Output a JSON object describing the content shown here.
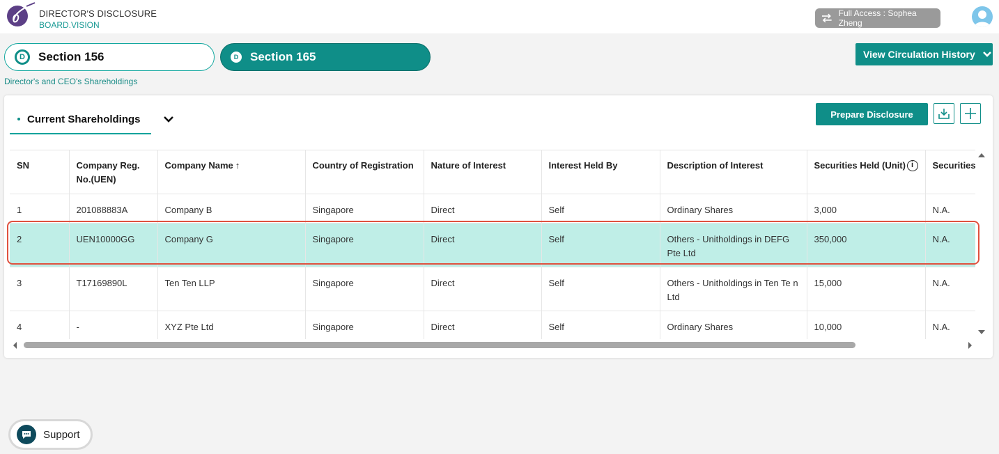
{
  "header": {
    "app_title": "DIRECTOR'S DISCLOSURE",
    "app_subtitle": "BOARD.VISION",
    "access_label": "Full Access : Sophea Zheng"
  },
  "sections": {
    "tab_156": "Section 156",
    "tab_165": "Section 165",
    "badge_letter": "D",
    "breadcrumb": "Director's and CEO's Shareholdings",
    "circulation_button": "View Circulation History"
  },
  "card": {
    "tab_label": "Current Shareholdings",
    "prepare_button": "Prepare Disclosure"
  },
  "table": {
    "columns": [
      "SN",
      "Company Reg. No.(UEN)",
      "Company Name",
      "Country of Registration",
      "Nature of Interest",
      "Interest Held By",
      "Description of Interest",
      "Securities Held (Unit)",
      "Securities"
    ],
    "sort_arrow": "↑",
    "info_glyph": "i",
    "rows": [
      [
        "1",
        "201088883A",
        "Company B",
        "Singapore",
        "Direct",
        "Self",
        "Ordinary Shares",
        "3,000",
        "N.A."
      ],
      [
        "2",
        "UEN10000GG",
        "Company G",
        "Singapore",
        "Direct",
        "Self",
        "Others - Unitholdings in DEFG Pte Ltd",
        "350,000",
        "N.A."
      ],
      [
        "3",
        "T17169890L",
        "Ten Ten LLP",
        "Singapore",
        "Direct",
        "Self",
        "Others - Unitholdings in Ten Te n Ltd",
        "15,000",
        "N.A."
      ],
      [
        "4",
        "-",
        "XYZ Pte Ltd",
        "Singapore",
        "Direct",
        "Self",
        "Ordinary Shares",
        "10,000",
        "N.A."
      ]
    ],
    "selected_row_sn": "2"
  },
  "support": {
    "label": "Support"
  },
  "colors": {
    "accent": "#0f8e88",
    "highlight_row": "#bfeee7",
    "selection_border": "#e0513f"
  },
  "icons": [
    "logo-icon",
    "swap-icon",
    "user-avatar-icon",
    "chevron-down-icon",
    "download-icon",
    "plus-icon",
    "info-icon",
    "chat-icon"
  ]
}
